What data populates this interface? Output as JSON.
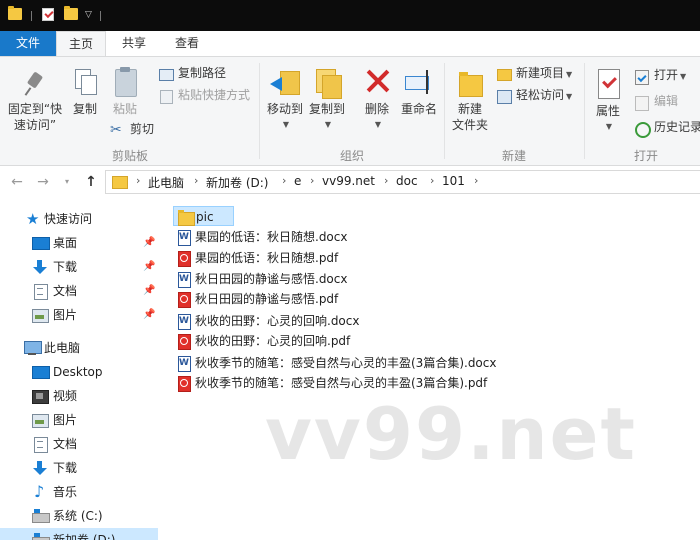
{
  "ribbon_tabs": {
    "file": "文件",
    "home": "主页",
    "share": "共享",
    "view": "查看"
  },
  "clipboard": {
    "pin_line1": "固定到“快",
    "pin_line2": "速访问”",
    "copy": "复制",
    "paste": "粘贴",
    "copy_path": "复制路径",
    "paste_shortcut": "粘贴快捷方式",
    "cut": "剪切",
    "group": "剪贴板"
  },
  "organize": {
    "move_to": "移动到",
    "copy_to": "复制到",
    "delete": "删除",
    "rename": "重命名",
    "group": "组织"
  },
  "new": {
    "new_folder_line1": "新建",
    "new_folder_line2": "文件夹",
    "new_item": "新建项目",
    "easy_access": "轻松访问",
    "group": "新建"
  },
  "open": {
    "properties": "属性",
    "open": "打开",
    "edit": "编辑",
    "history": "历史记录",
    "group": "打开"
  },
  "breadcrumb": [
    "此电脑",
    "新加卷 (D:)",
    "e",
    "vv99.net",
    "doc",
    "101"
  ],
  "nav": {
    "quick_access": "快速访问",
    "desktop_cn": "桌面",
    "downloads_cn": "下载",
    "documents_cn": "文档",
    "pictures_cn": "图片",
    "this_pc": "此电脑",
    "desktop": "Desktop",
    "videos": "视频",
    "pictures": "图片",
    "documents": "文档",
    "downloads": "下载",
    "music": "音乐",
    "system_c": "系统 (C:)",
    "new_volume_d": "新加卷 (D:)"
  },
  "files": [
    {
      "name": "pic",
      "type": "folder"
    },
    {
      "name": "果园的低语：秋日随想.docx",
      "type": "docx"
    },
    {
      "name": "果园的低语：秋日随想.pdf",
      "type": "pdf"
    },
    {
      "name": "秋日田园的静谧与感悟.docx",
      "type": "docx"
    },
    {
      "name": "秋日田园的静谧与感悟.pdf",
      "type": "pdf"
    },
    {
      "name": "秋收的田野：心灵的回响.docx",
      "type": "docx"
    },
    {
      "name": "秋收的田野：心灵的回响.pdf",
      "type": "pdf"
    },
    {
      "name": "秋收季节的随笔：感受自然与心灵的丰盈(3篇合集).docx",
      "type": "docx"
    },
    {
      "name": "秋收季节的随笔：感受自然与心灵的丰盈(3篇合集).pdf",
      "type": "pdf"
    }
  ],
  "watermark": "vv99.net",
  "colors": {
    "accent": "#1979ca",
    "selection": "#cce8ff",
    "titlebar": "#0c0c0c",
    "ribbon_bg": "#f5f6f7"
  }
}
